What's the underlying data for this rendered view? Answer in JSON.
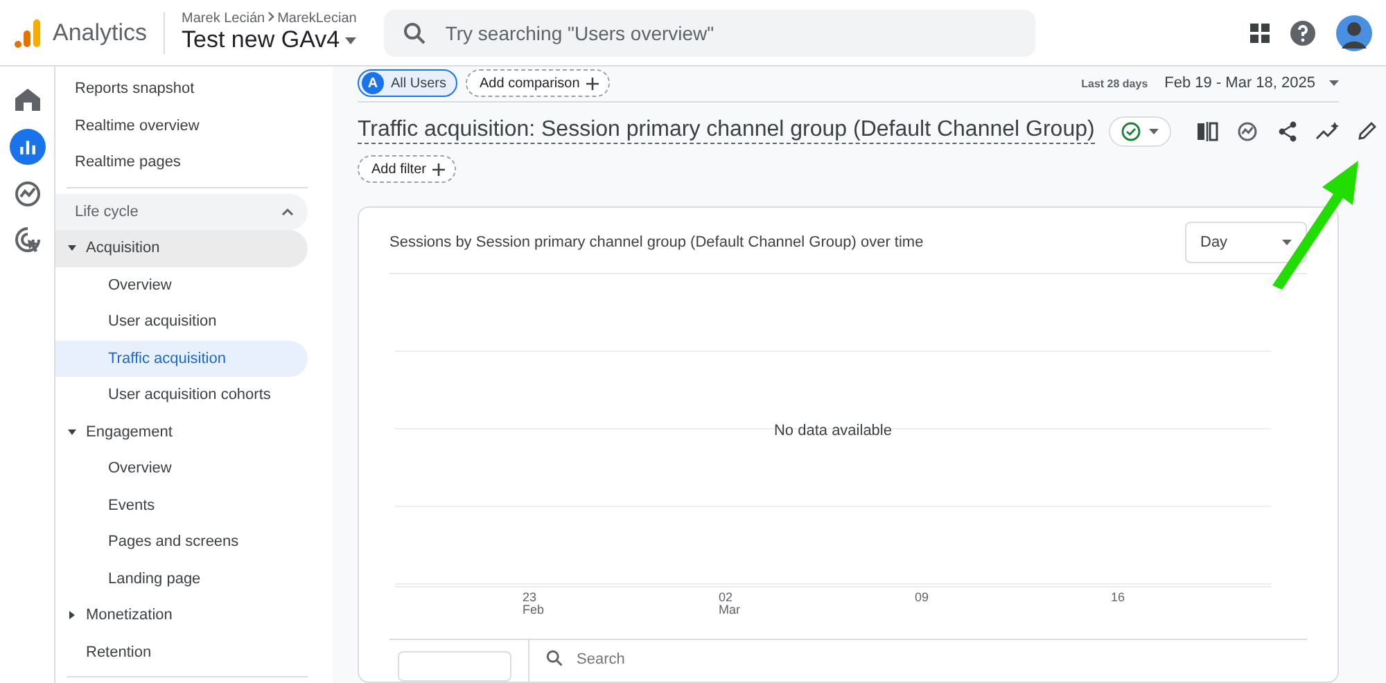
{
  "header": {
    "app_name": "Analytics",
    "breadcrumb": [
      "Marek Lecián",
      "MarekLecian"
    ],
    "property": "Test new GAv4",
    "search": {
      "placeholder": "Try searching \"Users overview\""
    }
  },
  "rail": [
    {
      "selected": false
    },
    {
      "selected": true
    },
    {
      "selected": false
    },
    {
      "selected": false
    }
  ],
  "nav": {
    "top_items": [
      {
        "label": "Reports snapshot",
        "selected": false
      },
      {
        "label": "Realtime overview",
        "selected": false
      },
      {
        "label": "Realtime pages",
        "selected": false
      }
    ],
    "section": {
      "label": "Life cycle",
      "expanded": true,
      "groups": [
        {
          "label": "Acquisition",
          "expanded": true,
          "children": [
            {
              "label": "Overview",
              "selected": false
            },
            {
              "label": "User acquisition",
              "selected": false
            },
            {
              "label": "Traffic acquisition",
              "selected": true
            },
            {
              "label": "User acquisition cohorts",
              "selected": false
            }
          ]
        },
        {
          "label": "Engagement",
          "expanded": true,
          "children": [
            {
              "label": "Overview",
              "selected": false
            },
            {
              "label": "Events",
              "selected": false
            },
            {
              "label": "Pages and screens",
              "selected": false
            },
            {
              "label": "Landing page",
              "selected": false
            }
          ]
        },
        {
          "label": "Monetization",
          "expanded": false
        },
        {
          "label": "Retention",
          "kind": "leaf",
          "expanded": false
        }
      ]
    }
  },
  "toolbar": {
    "segment": {
      "badge": "A",
      "label": "All Users"
    },
    "add_comparison": "Add comparison",
    "date_range_label": "Last 28 days",
    "date_range": "Feb 19 - Mar 18, 2025"
  },
  "report": {
    "title": "Traffic acquisition: Session primary channel group (Default Channel Group)",
    "add_filter": "Add filter"
  },
  "chart_card": {
    "title": "Sessions by Session primary channel group (Default Channel Group) over time",
    "interval": "Day",
    "empty_message": "No data available",
    "x_labels": [
      {
        "day": "23",
        "month": "Feb"
      },
      {
        "day": "02",
        "month": "Mar"
      },
      {
        "day": "09"
      },
      {
        "day": "16"
      }
    ]
  },
  "table": {
    "search": {
      "placeholder": "Search"
    }
  }
}
